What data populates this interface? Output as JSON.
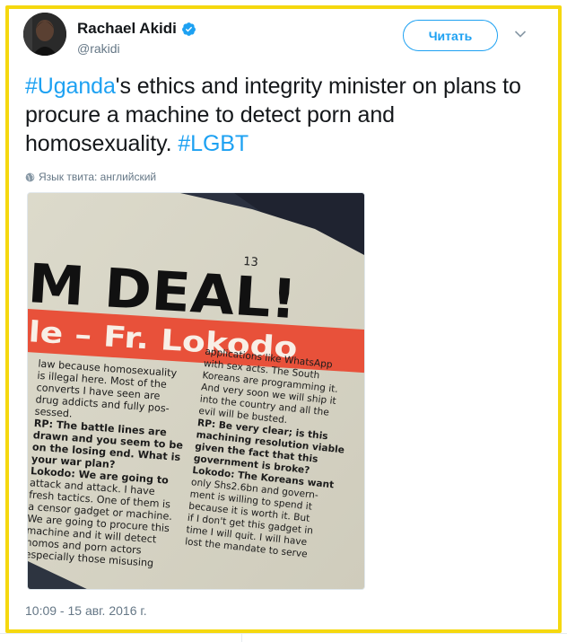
{
  "author": {
    "name": "Rachael Akidi",
    "handle": "@rakidi",
    "verified": true
  },
  "follow_button": {
    "label": "Читать"
  },
  "tweet": {
    "parts": [
      {
        "text": "#Uganda",
        "type": "hashtag"
      },
      {
        "text": "'s ethics and integrity minister on plans to procure a machine to detect porn and homosexuality. ",
        "type": "text"
      },
      {
        "text": "#LGBT",
        "type": "hashtag"
      }
    ]
  },
  "language_note": "Язык твита: английский",
  "newspaper": {
    "page_mark": "13",
    "headline": "M DEAL!",
    "subheadline": "le – Fr. Lokodo",
    "left_column": [
      "law because homosexuality",
      "is illegal here. Most of the",
      "converts I have seen are",
      "drug addicts and fully pos-",
      "sessed.",
      "RP: The battle lines are",
      "drawn and you seem to be",
      "on the losing end. What is",
      "your war plan?",
      "Lokodo: We are going to",
      "attack and attack. I have",
      "fresh tactics. One of them is",
      "a censor gadget or machine.",
      "We are going to procure this",
      "machine and it will detect",
      "homos and porn actors",
      "especially those misusing"
    ],
    "right_column": [
      "applications like WhatsApp",
      "with sex acts. The South",
      "Koreans are programming it.",
      "And very soon we will ship it",
      "into the country and all the",
      "evil will be busted.",
      "RP: Be very clear; is this",
      "machining resolution viable",
      "given the fact that this",
      "government is broke?",
      "Lokodo: The Koreans want",
      "only Shs2.6bn and govern-",
      "ment is willing to spend it",
      "because it is worth it. But",
      "if I don't get this gadget in",
      "time I will quit. I will have",
      "lost the mandate to serve"
    ]
  },
  "timestamp": "10:09 - 15 авг. 2016 г.",
  "colors": {
    "accent": "#1da1f2",
    "frame": "#f5d80f",
    "secondary_text": "#657786",
    "headline_red": "#e8513a"
  },
  "icons": {
    "verified": "verified-badge-icon",
    "caret": "chevron-down-icon",
    "globe": "globe-icon"
  }
}
